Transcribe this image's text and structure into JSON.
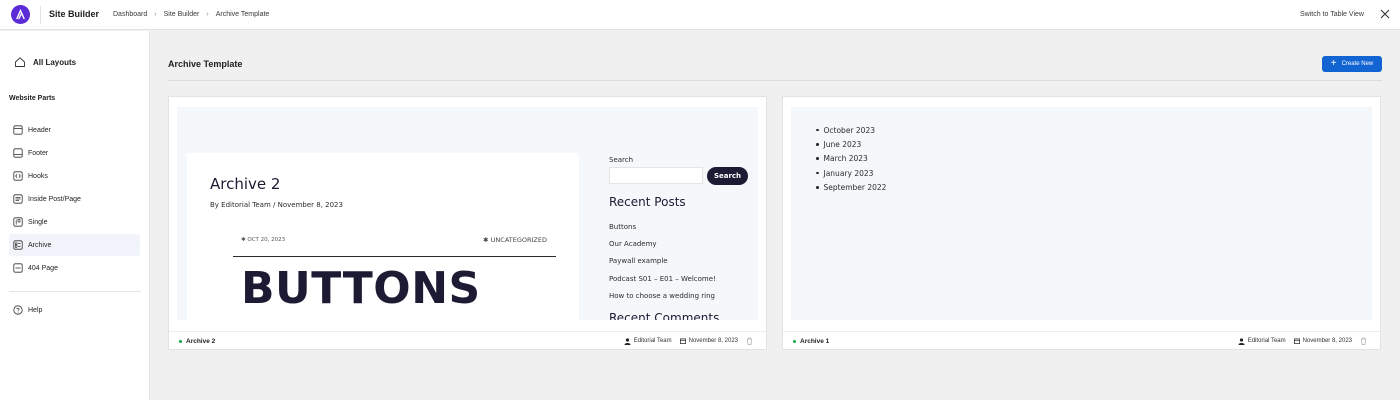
{
  "topbar": {
    "app_title": "Site Builder",
    "breadcrumbs": [
      "Dashboard",
      "Site Builder",
      "Archive Template"
    ],
    "switch_view": "Switch to Table View"
  },
  "sidebar": {
    "all_layouts": "All Layouts",
    "section_title": "Website Parts",
    "items": [
      {
        "label": "Header",
        "icon": "header-icon"
      },
      {
        "label": "Footer",
        "icon": "footer-icon"
      },
      {
        "label": "Hooks",
        "icon": "hooks-icon"
      },
      {
        "label": "Inside Post/Page",
        "icon": "inside-post-icon"
      },
      {
        "label": "Single",
        "icon": "single-icon"
      },
      {
        "label": "Archive",
        "icon": "archive-icon",
        "active": true
      },
      {
        "label": "404 Page",
        "icon": "404-page-icon"
      }
    ],
    "help": "Help"
  },
  "main": {
    "title": "Archive Template",
    "create_button": "Create New"
  },
  "cards": [
    {
      "name": "Archive 2",
      "author": "Editorial Team",
      "date": "November 8, 2023",
      "preview": {
        "post_title": "Archive 2",
        "post_meta": "By Editorial Team / November 8, 2023",
        "post_date": "OCT 20, 2023",
        "post_category": "UNCATEGORIZED",
        "headline": "BUTTONS",
        "search_label": "Search",
        "search_button": "Search",
        "recent_posts_title": "Recent Posts",
        "recent_posts": [
          "Buttons",
          "Our Academy",
          "Paywall example",
          "Podcast S01 – E01 – Welcome!",
          "How to choose a wedding ring"
        ],
        "recent_comments_title": "Recent Comments"
      }
    },
    {
      "name": "Archive 1",
      "author": "Editorial Team",
      "date": "November 8, 2023",
      "preview": {
        "archives": [
          "October 2023",
          "June 2023",
          "March 2023",
          "January 2023",
          "September 2022"
        ]
      }
    }
  ],
  "colors": {
    "brand": "#5b2bd6",
    "primary_button": "#1264d3",
    "status_dot": "#16a34a"
  }
}
